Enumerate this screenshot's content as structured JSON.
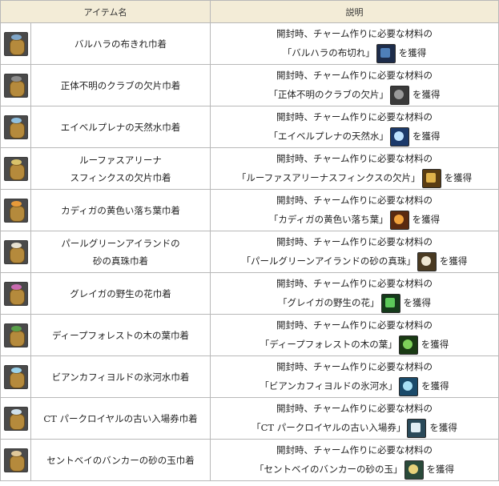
{
  "header": {
    "col_name": "アイテム名",
    "col_desc": "説明"
  },
  "desc_prefix": "開封時、チャーム作りに必要な材料の",
  "desc_suffix": "を獲得",
  "rows": [
    {
      "name": "バルハラの布きれ巾着",
      "material": "「バルハラの布切れ」",
      "bag_color": "#7fa6c9",
      "mat_color": "#4f7fb8",
      "mat_bg": "#1d2c4a"
    },
    {
      "name": "正体不明のクラブの欠片巾着",
      "material": "「正体不明のクラブの欠片」",
      "bag_color": "#8c8c8c",
      "mat_color": "#9a9a9a",
      "mat_bg": "#3a3a3a"
    },
    {
      "name": "エイベルプレナの天然水巾着",
      "material": "「エイベルプレナの天然水」",
      "bag_color": "#8fc0e0",
      "mat_color": "#bfe3ff",
      "mat_bg": "#1c3a6b"
    },
    {
      "name_lines": [
        "ルーファスアリーナ",
        "スフィンクスの欠片巾着"
      ],
      "material": "「ルーファスアリーナスフィンクスの欠片」",
      "bag_color": "#d9c26a",
      "mat_color": "#e0b24a",
      "mat_bg": "#5a3c12"
    },
    {
      "name": "カディガの黄色い落ち葉巾着",
      "material": "「カディガの黄色い落ち葉」",
      "bag_color": "#e89a3a",
      "mat_color": "#f0a23c",
      "mat_bg": "#5a2a10"
    },
    {
      "name_lines": [
        "パールグリーンアイランドの",
        "砂の真珠巾着"
      ],
      "material": "「パールグリーンアイランドの砂の真珠」",
      "bag_color": "#e8e2d2",
      "mat_color": "#eee6d2",
      "mat_bg": "#4a3a22"
    },
    {
      "name": "グレイガの野生の花巾着",
      "material": "「グレイガの野生の花」",
      "bag_color": "#c86ab0",
      "mat_color": "#5cc85a",
      "mat_bg": "#143a1a"
    },
    {
      "name": "ディープフォレストの木の葉巾着",
      "material": "「ディープフォレストの木の葉」",
      "bag_color": "#5aa04a",
      "mat_color": "#7ed05a",
      "mat_bg": "#1a3a14"
    },
    {
      "name": "ビアンカフィヨルドの氷河水巾着",
      "material": "「ビアンカフィヨルドの氷河水」",
      "bag_color": "#9ad2ea",
      "mat_color": "#a8e0f5",
      "mat_bg": "#1a4a6a"
    },
    {
      "name": "CT パークロイヤルの古い入場券巾着",
      "material": "「CT パークロイヤルの古い入場券」",
      "bag_color": "#cfe0ea",
      "mat_color": "#e0eef5",
      "mat_bg": "#2a4a5a"
    },
    {
      "name": "セントベイのバンカーの砂の玉巾着",
      "material": "「セントベイのバンカーの砂の玉」",
      "bag_color": "#e0c89a",
      "mat_color": "#e8d27a",
      "mat_bg": "#2a4a3a"
    }
  ]
}
